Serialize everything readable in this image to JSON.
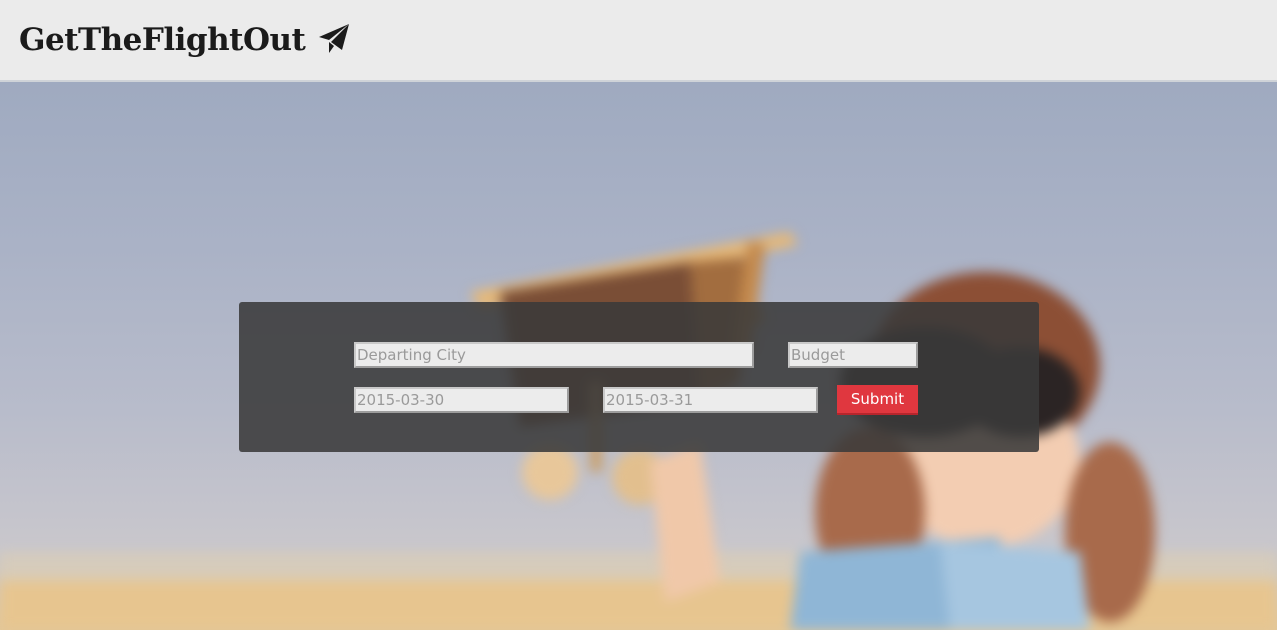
{
  "header": {
    "title": "GetTheFlightOut",
    "icon": "paper-plane-icon"
  },
  "hero": {
    "image": "child-holding-toy-biplane-photo"
  },
  "search_form": {
    "departing_city": {
      "placeholder": "Departing City",
      "value": ""
    },
    "budget": {
      "placeholder": "Budget",
      "value": ""
    },
    "depart_date": {
      "placeholder": "2015-03-30",
      "value": ""
    },
    "return_date": {
      "placeholder": "2015-03-31",
      "value": ""
    },
    "submit_label": "Submit"
  },
  "colors": {
    "header_bg": "#ebebeb",
    "panel_bg": "#3a3a3a",
    "submit_bg": "#e0373f"
  }
}
